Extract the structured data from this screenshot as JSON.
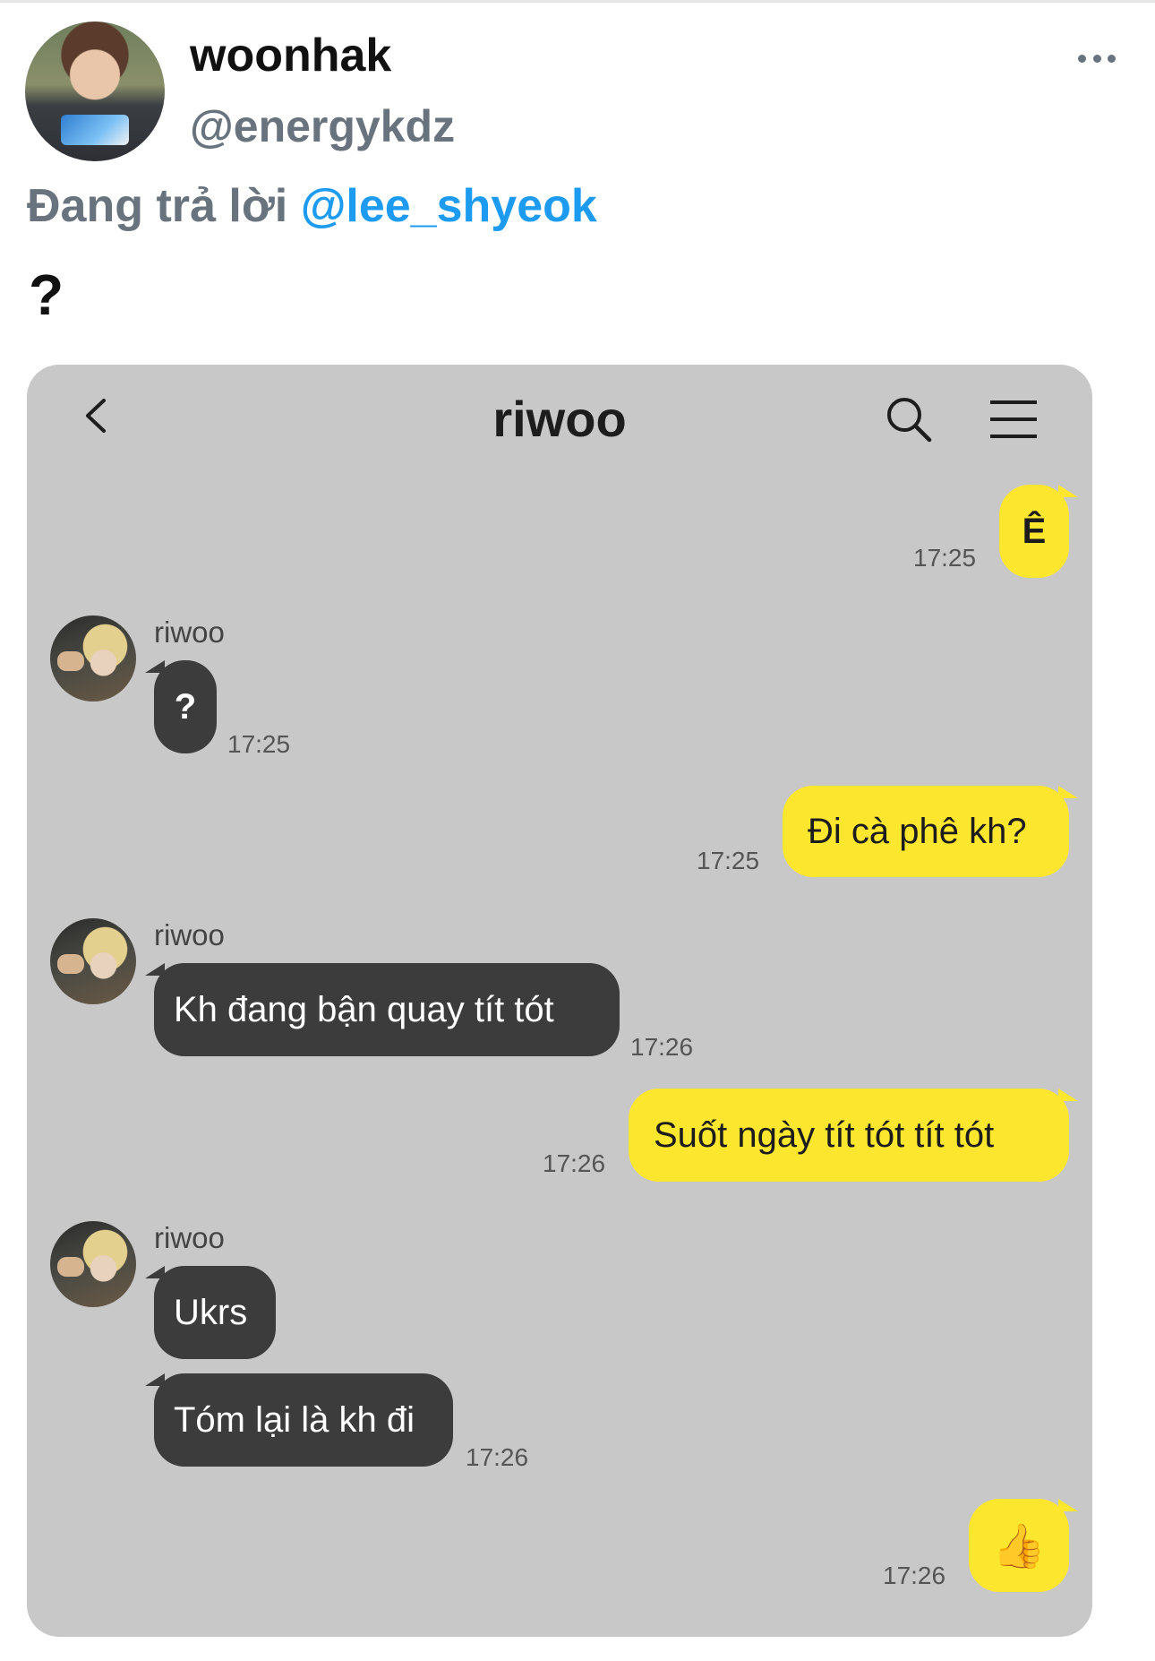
{
  "tweet": {
    "display_name": "woonhak",
    "handle": "@energykdz",
    "reply_prefix": "Đang trả lời",
    "reply_to": "@lee_shyeok",
    "text": "?"
  },
  "chat": {
    "title": "riwoo",
    "messages": [
      {
        "direction": "out",
        "text": "Ê",
        "time": "17:25"
      },
      {
        "direction": "in",
        "sender": "riwoo",
        "text": "?",
        "time": "17:25"
      },
      {
        "direction": "out",
        "text": "Đi cà phê kh?",
        "time": "17:25"
      },
      {
        "direction": "in",
        "sender": "riwoo",
        "text": "Kh đang bận quay tít tót",
        "time": "17:26"
      },
      {
        "direction": "out",
        "text": "Suốt ngày tít tót tít tót",
        "time": "17:26"
      },
      {
        "direction": "in",
        "sender": "riwoo",
        "text": "Ukrs"
      },
      {
        "direction": "in",
        "text": "Tóm lại là kh đi",
        "time": "17:26"
      },
      {
        "direction": "out",
        "text": "👍",
        "time": "17:26"
      }
    ]
  },
  "colors": {
    "mention": "#1d9bf0",
    "chat_background": "#c8c8c8",
    "outgoing_bubble": "#fde62e",
    "incoming_bubble": "#3c3c3c"
  },
  "icons": [
    "more-icon",
    "back-icon",
    "search-icon",
    "menu-icon",
    "thumbs-up-icon"
  ]
}
